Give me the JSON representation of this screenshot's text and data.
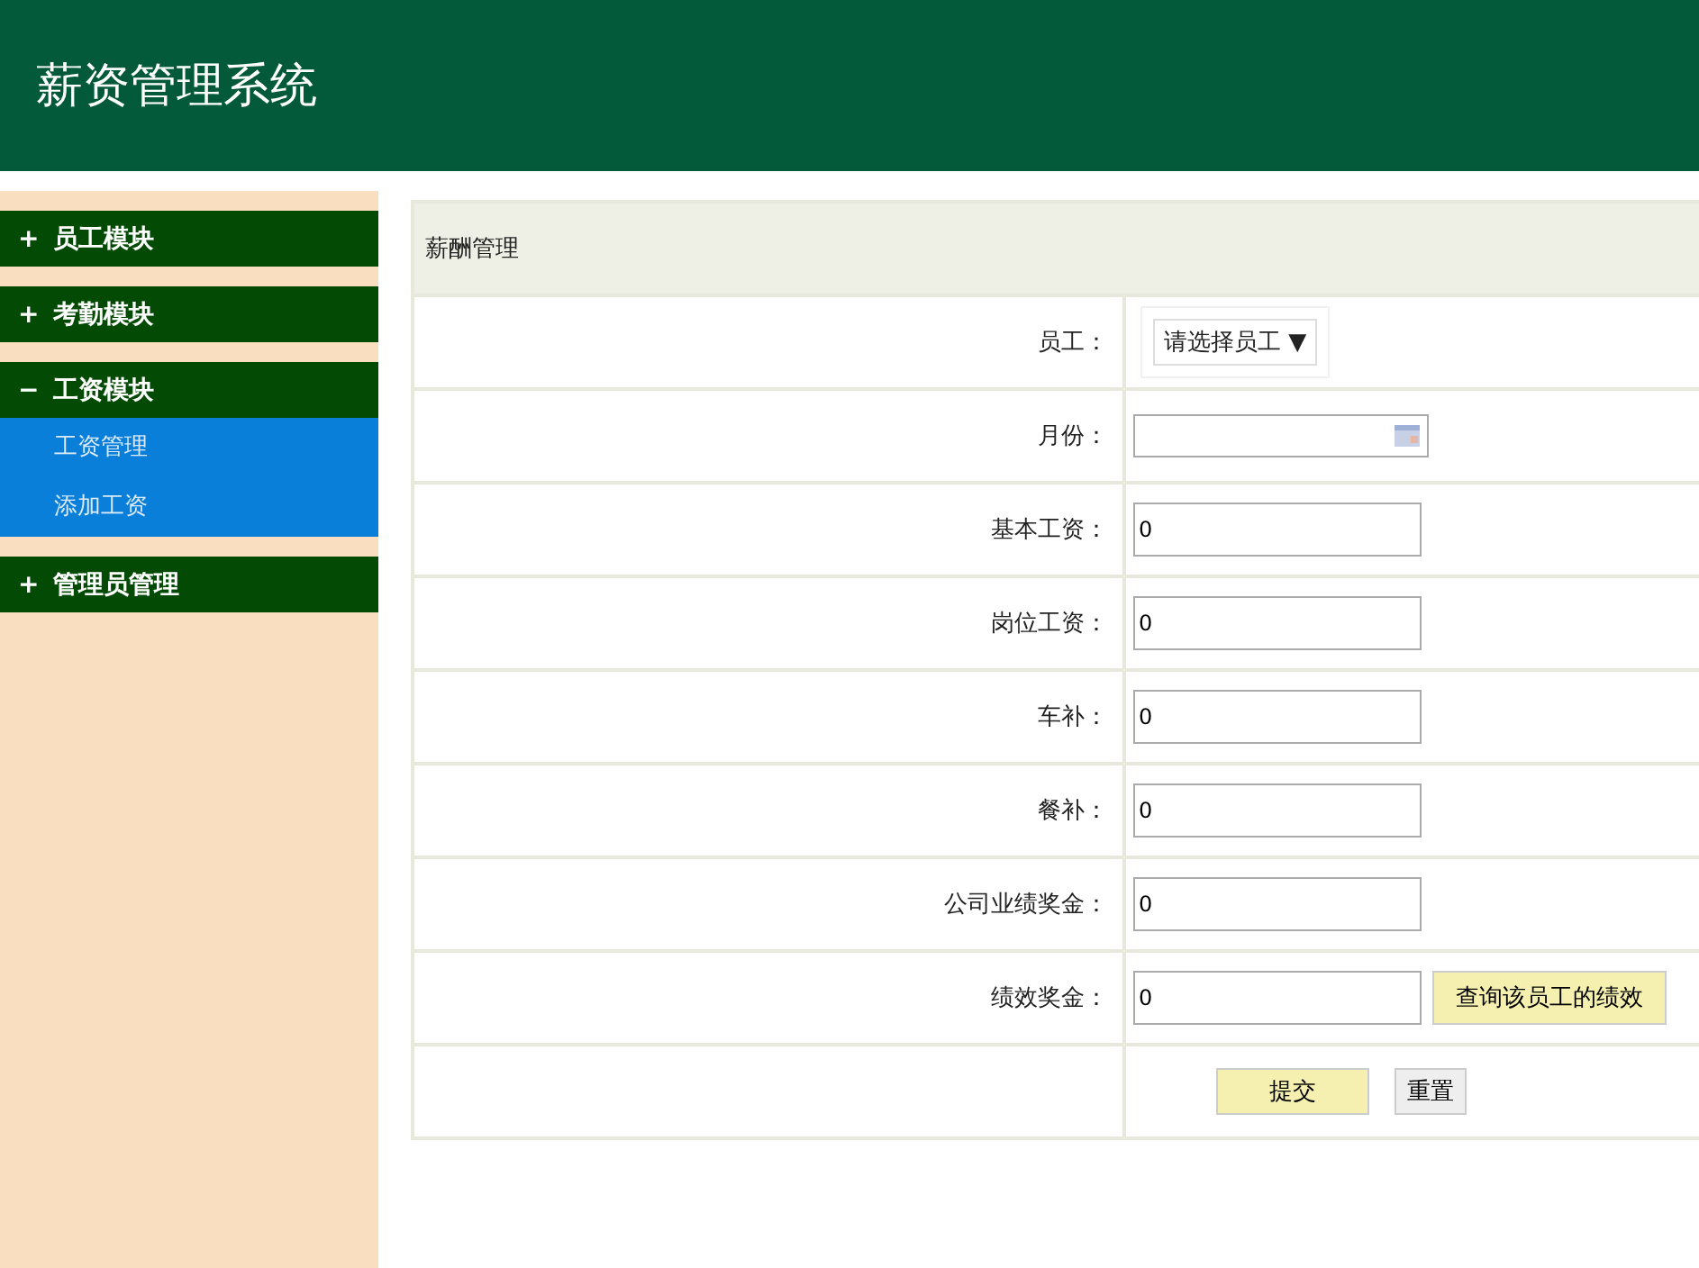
{
  "header": {
    "title": "薪资管理系统"
  },
  "sidebar": {
    "modules": [
      {
        "sign": "+",
        "label": "员工模块"
      },
      {
        "sign": "+",
        "label": "考勤模块"
      },
      {
        "sign": "−",
        "label": "工资模块",
        "children": [
          {
            "label": "工资管理"
          },
          {
            "label": "添加工资"
          }
        ]
      },
      {
        "sign": "+",
        "label": "管理员管理"
      }
    ]
  },
  "form": {
    "title": "薪酬管理",
    "fields": [
      {
        "kind": "select",
        "label": "员工：",
        "value": "请选择员工",
        "caret": "▼"
      },
      {
        "kind": "date",
        "label": "月份："
      },
      {
        "kind": "text",
        "label": "基本工资：",
        "value": "0"
      },
      {
        "kind": "text",
        "label": "岗位工资：",
        "value": "0"
      },
      {
        "kind": "text",
        "label": "车补：",
        "value": "0"
      },
      {
        "kind": "text",
        "label": "餐补：",
        "value": "0"
      },
      {
        "kind": "text",
        "label": "公司业绩奖金：",
        "value": "0"
      },
      {
        "kind": "text",
        "label": "绩效奖金：",
        "value": "0",
        "button": "查询该员工的绩效"
      }
    ],
    "buttons": [
      {
        "kind": "submit",
        "label": "提交"
      },
      {
        "kind": "reset",
        "label": "重置"
      }
    ]
  }
}
